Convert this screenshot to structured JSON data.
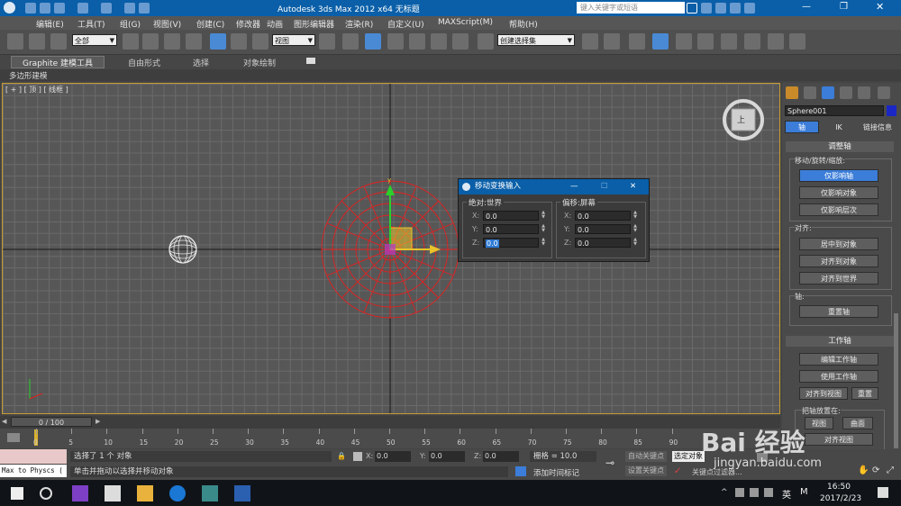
{
  "window": {
    "title": "Autodesk 3ds Max  2012 x64     无标题",
    "search_placeholder": "键入关键字或短语"
  },
  "menu": [
    "编辑(E)",
    "工具(T)",
    "组(G)",
    "视图(V)",
    "创建(C)",
    "修改器",
    "动画",
    "图形编辑器",
    "渲染(R)",
    "自定义(U)",
    "MAXScript(M)",
    "帮助(H)"
  ],
  "toolbar": {
    "filter_select": "全部",
    "ref_coord_select": "视图",
    "named_selection_select": "创建选择集"
  },
  "ribbon": {
    "tabs": [
      "Graphite 建模工具",
      "自由形式",
      "选择",
      "对象绘制"
    ],
    "subtitle": "多边形建模"
  },
  "viewport": {
    "label": "[ + ] [ 顶 ] [ 线框 ]",
    "viewcube_face": "上"
  },
  "dialog": {
    "title": "移动变换输入",
    "absolute_group": "绝对:世界",
    "offset_group": "偏移:屏幕",
    "absolute": [
      {
        "axis": "X:",
        "value": "0.0"
      },
      {
        "axis": "Y:",
        "value": "0.0"
      },
      {
        "axis": "Z:",
        "value": "0.0"
      }
    ],
    "offset": [
      {
        "axis": "X:",
        "value": "0.0"
      },
      {
        "axis": "Y:",
        "value": "0.0"
      },
      {
        "axis": "Z:",
        "value": "0.0"
      }
    ]
  },
  "command_panel": {
    "object_name": "Sphere001",
    "color": "#1b27c4",
    "tabs": [
      "轴",
      "IK",
      "链接信息"
    ],
    "rollout_adjust": "调整轴",
    "move_rotate_scale": "移动/旋转/缩放:",
    "affect_pivot_only": "仅影响轴",
    "affect_object_only": "仅影响对象",
    "affect_hierarchy_only": "仅影响层次",
    "align_label": "对齐:",
    "center_to_object": "居中到对象",
    "align_to_object": "对齐到对象",
    "align_to_world": "对齐到世界",
    "pivot_label": "轴:",
    "reset_pivot": "重置轴",
    "rollout_working": "工作轴",
    "edit_working_pivot": "编辑工作轴",
    "use_working_pivot": "使用工作轴",
    "align_to_view": "对齐到视图",
    "reset": "重置",
    "place_pivot_to": "把轴放置在:",
    "view": "视图",
    "surface": "曲面",
    "align_to_view2": "对齐视图"
  },
  "timeline": {
    "frame_counter": "0 / 100",
    "ticks": [
      "0",
      "5",
      "10",
      "15",
      "20",
      "25",
      "30",
      "35",
      "40",
      "45",
      "50",
      "55",
      "60",
      "65",
      "70",
      "75",
      "80",
      "85",
      "90"
    ]
  },
  "status": {
    "script_listener": "Max to Physcs (",
    "selected_text": "选择了 1 个 对象",
    "prompt_text": "单击并拖动以选择并移动对象",
    "x_label": "X:",
    "x_value": "0.0",
    "y_label": "Y:",
    "y_value": "0.0",
    "z_label": "Z:",
    "z_value": "0.0",
    "grid_text": "栅格 = 10.0",
    "add_time_tag": "添加时间标记",
    "auto_key": "自动关键点",
    "set_key": "设置关键点",
    "selected_dd": "选定对象",
    "key_filters": "关键点过滤器..."
  },
  "taskbar": {
    "ime": "英",
    "input_mode": "M",
    "time": "16:50",
    "date": "2017/2/23"
  },
  "watermark": {
    "brand": "Bai 经验",
    "url": "jingyan.baidu.com"
  }
}
